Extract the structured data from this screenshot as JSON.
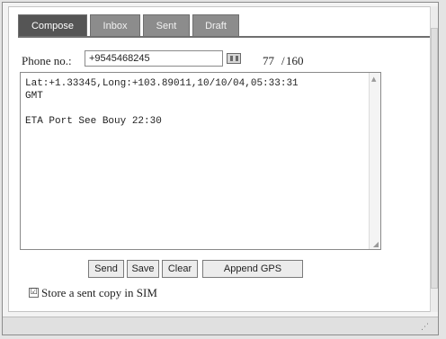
{
  "tabs": [
    {
      "label": "Compose",
      "active": true
    },
    {
      "label": "Inbox",
      "active": false
    },
    {
      "label": "Sent",
      "active": false
    },
    {
      "label": "Draft",
      "active": false
    }
  ],
  "phone": {
    "label": "Phone no.:",
    "value": "+9545468245"
  },
  "char_counter": {
    "count": "77",
    "separator": "/",
    "max": "160"
  },
  "message": {
    "lines": [
      "Lat:+1.33345,Long:+103.89011,10/10/04,05:33:31",
      "GMT",
      "",
      "ETA Port See Bouy 22:30"
    ]
  },
  "buttons": {
    "send": "Send",
    "save": "Save",
    "clear": "Clear",
    "append_gps": "Append GPS"
  },
  "store_copy": {
    "label": "Store a sent copy in SIM",
    "checked": true,
    "mark": "☑"
  },
  "icons": {
    "contacts": "contacts-icon",
    "grip": "resize-grip-icon"
  },
  "colors": {
    "tab_active": "#555555",
    "tab_inactive": "#8c8c8c"
  }
}
